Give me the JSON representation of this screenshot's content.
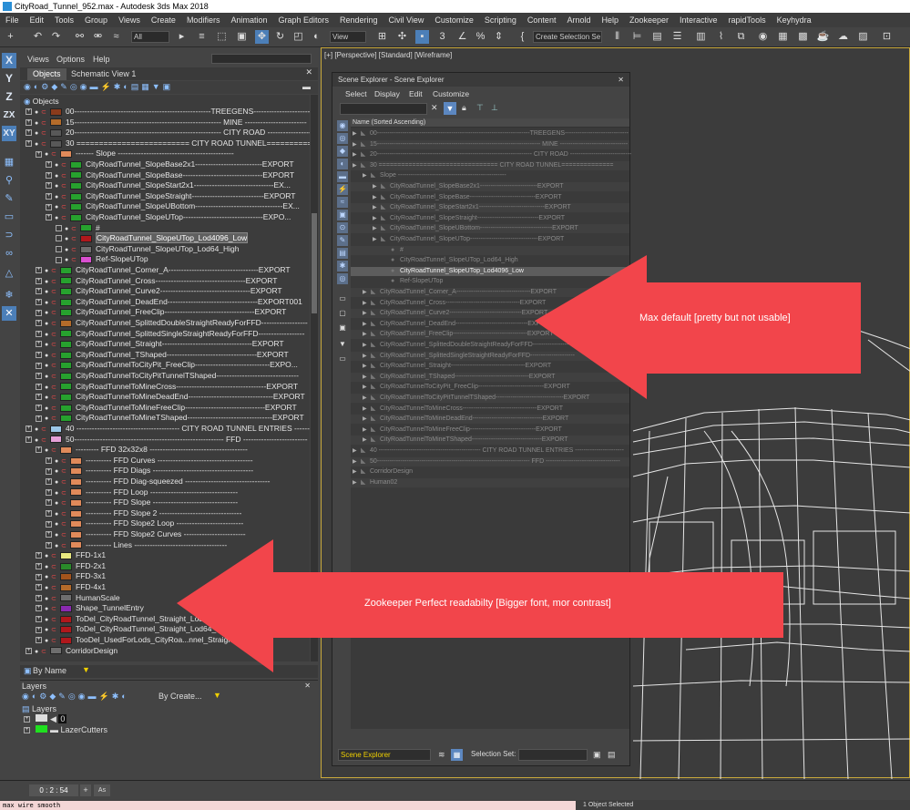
{
  "window": {
    "title": "CityRoad_Tunnel_952.max - Autodesk 3ds Max 2018"
  },
  "menu": [
    "File",
    "Edit",
    "Tools",
    "Group",
    "Views",
    "Create",
    "Modifiers",
    "Animation",
    "Graph Editors",
    "Rendering",
    "Civil View",
    "Customize",
    "Scripting",
    "Content",
    "Arnold",
    "Help",
    "Zookeeper",
    "Interactive",
    "rapidTools",
    "Keyhydra"
  ],
  "toolbar": {
    "filter_select": "All",
    "ref_coord": "View",
    "selection_set": "Create Selection Se"
  },
  "axis_buttons": [
    "X",
    "Y",
    "Z",
    "ZX",
    "XY"
  ],
  "left_panel": {
    "menu": [
      "Views",
      "Options",
      "Help"
    ],
    "tabs": [
      "Objects",
      "Schematic View 1"
    ],
    "root": "Objects",
    "rows": [
      {
        "text": "00-----------------------------------------------------TREEGENS----------------------------",
        "swatch": "#8a3b1c",
        "indent": 0,
        "sel": false
      },
      {
        "text": "15--------------------------------------------------------- MINE ------------------------",
        "swatch": "#b36b2a",
        "indent": 0,
        "sel": false
      },
      {
        "text": "20--------------------------------------------------------- CITY  ROAD -------------------",
        "swatch": "#585858",
        "indent": 0,
        "sel": false
      },
      {
        "text": "30  ========================= CITY ROAD TUNNEL==========",
        "swatch": "#585858",
        "indent": 0,
        "sel": false
      },
      {
        "text": "------- Slope ---------------------------------------------",
        "swatch": "#e08a5a",
        "indent": 1,
        "sel": false
      },
      {
        "text": "CityRoadTunnel_SlopeBase2x1--------------------------EXPORT",
        "swatch": "#27a12e",
        "indent": 2,
        "sel": false
      },
      {
        "text": "CityRoadTunnel_SlopeBase-------------------------------EXPORT",
        "swatch": "#27a12e",
        "indent": 2,
        "sel": false
      },
      {
        "text": "CityRoadTunnel_SlopeStart2x1-------------------------------EX...",
        "swatch": "#27a12e",
        "indent": 2,
        "sel": false
      },
      {
        "text": "CityRoadTunnel_SlopeStraight----------------------------EXPORT",
        "swatch": "#27a12e",
        "indent": 2,
        "sel": false
      },
      {
        "text": "CityRoadTunnel_SlopeUBottom----------------------------------EX...",
        "swatch": "#27a12e",
        "indent": 2,
        "sel": false
      },
      {
        "text": "CityRoadTunnel_SlopeUTop-------------------------------EXPO...",
        "swatch": "#27a12e",
        "indent": 2,
        "sel": false
      },
      {
        "text": "#",
        "swatch": "#27a12e",
        "indent": 3,
        "sel": false
      },
      {
        "text": "CityRoadTunnel_SlopeUTop_Lod4096_Low",
        "swatch": "#b0181c",
        "indent": 3,
        "sel": true
      },
      {
        "text": "CityRoadTunnel_SlopeUTop_Lod64_High",
        "swatch": "#6e6e6e",
        "indent": 3,
        "sel": false
      },
      {
        "text": "Ref-SlopeUTop",
        "swatch": "#d94fd0",
        "indent": 3,
        "sel": false
      },
      {
        "text": "CityRoadTunnel_Corner_A-----------------------------------EXPORT",
        "swatch": "#27a12e",
        "indent": 1,
        "sel": false
      },
      {
        "text": "CityRoadTunnel_Cross-----------------------------------EXPORT",
        "swatch": "#27a12e",
        "indent": 1,
        "sel": false
      },
      {
        "text": "CityRoadTunnel_Curve2-----------------------------------EXPORT",
        "swatch": "#27a12e",
        "indent": 1,
        "sel": false
      },
      {
        "text": "CityRoadTunnel_DeadEnd-----------------------------------EXPORT001",
        "swatch": "#27a12e",
        "indent": 1,
        "sel": false
      },
      {
        "text": "CityRoadTunnel_FreeClip-----------------------------------EXPORT",
        "swatch": "#27a12e",
        "indent": 1,
        "sel": false
      },
      {
        "text": "CityRoadTunnel_SplittedDoubleStraightReadyForFFD------------------",
        "swatch": "#b36b2a",
        "indent": 1,
        "sel": false
      },
      {
        "text": "CityRoadTunnel_SplittedSingleStraightReadyForFFD------------------",
        "swatch": "#27a12e",
        "indent": 1,
        "sel": false
      },
      {
        "text": "CityRoadTunnel_Straight-----------------------------------EXPORT",
        "swatch": "#27a12e",
        "indent": 1,
        "sel": false
      },
      {
        "text": "CityRoadTunnel_TShaped-----------------------------------EXPORT",
        "swatch": "#27a12e",
        "indent": 1,
        "sel": false
      },
      {
        "text": "CityRoadTunnelToCityPit_FreeClip-----------------------------EXPO...",
        "swatch": "#27a12e",
        "indent": 1,
        "sel": false
      },
      {
        "text": "CityRoadTunnelToCityPitTunnelTShaped--------------------------------",
        "swatch": "#27a12e",
        "indent": 1,
        "sel": false
      },
      {
        "text": "CityRoadTunnelToMineCross-----------------------------------EXPORT",
        "swatch": "#27a12e",
        "indent": 1,
        "sel": false
      },
      {
        "text": "CityRoadTunnelToMineDeadEnd---------------------------------EXPORT",
        "swatch": "#27a12e",
        "indent": 1,
        "sel": false
      },
      {
        "text": "CityRoadTunnelToMineFreeClip-------------------------------EXPORT",
        "swatch": "#27a12e",
        "indent": 1,
        "sel": false
      },
      {
        "text": "CityRoadTunnelToMineTShaped---------------------------------EXPORT",
        "swatch": "#27a12e",
        "indent": 1,
        "sel": false
      },
      {
        "text": "40  ---------------------------------------- CITY ROAD TUNNEL ENTRIES ----------",
        "swatch": "#9cc7e8",
        "indent": 0,
        "sel": false
      },
      {
        "text": "50---------------------------------------------------------- FFD -------------------------",
        "swatch": "#e6a0d8",
        "indent": 0,
        "sel": false
      },
      {
        "text": "--------- FFD 32x32x8 --------------------------------------",
        "swatch": "#e08a5a",
        "indent": 1,
        "sel": false
      },
      {
        "text": "---------- FFD Curves -------------------------------------",
        "swatch": "#e08a5a",
        "indent": 2,
        "sel": false
      },
      {
        "text": "---------- FFD Diags ---------------------------------------",
        "swatch": "#e08a5a",
        "indent": 2,
        "sel": false
      },
      {
        "text": "---------- FFD Diag-squeezed ---------------------------------",
        "swatch": "#e08a5a",
        "indent": 2,
        "sel": false
      },
      {
        "text": "---------- FFD Loop ----------------------------------",
        "swatch": "#e08a5a",
        "indent": 2,
        "sel": false
      },
      {
        "text": "---------- FFD Slope ---------------------------------",
        "swatch": "#e08a5a",
        "indent": 2,
        "sel": false
      },
      {
        "text": "---------- FFD Slope 2 --------------------------------",
        "swatch": "#e08a5a",
        "indent": 2,
        "sel": false
      },
      {
        "text": "---------- FFD Slope2  Loop --------------------------",
        "swatch": "#e08a5a",
        "indent": 2,
        "sel": false
      },
      {
        "text": "---------- FFD Slope2 Curves ------------------------",
        "swatch": "#e08a5a",
        "indent": 2,
        "sel": false
      },
      {
        "text": "---------- Lines ------------------------------------",
        "swatch": "#e08a5a",
        "indent": 2,
        "sel": false
      },
      {
        "text": "FFD-1x1",
        "swatch": "#e8e880",
        "indent": 1,
        "sel": false
      },
      {
        "text": "FFD-2x1",
        "swatch": "#2a8a2a",
        "indent": 1,
        "sel": false
      },
      {
        "text": "FFD-3x1",
        "swatch": "#a3541c",
        "indent": 1,
        "sel": false
      },
      {
        "text": "FFD-4x1",
        "swatch": "#b36b2a",
        "indent": 1,
        "sel": false
      },
      {
        "text": "HumanScale",
        "swatch": "#6e6e6e",
        "indent": 1,
        "sel": false
      },
      {
        "text": "Shape_TunnelEntry",
        "swatch": "#8a2ab0",
        "indent": 1,
        "sel": false
      },
      {
        "text": "ToDel_CityRoadTunnel_Straight_Lod...",
        "swatch": "#b0181c",
        "indent": 1,
        "sel": false
      },
      {
        "text": "ToDel_CityRoadTunnel_Straight_Lod64_H...",
        "swatch": "#b0181c",
        "indent": 1,
        "sel": false
      },
      {
        "text": "TooDel_UsedForLods_CityRoa...nnel_Straight_...w001",
        "swatch": "#b0181c",
        "indent": 1,
        "sel": false
      },
      {
        "text": "CorridorDesign",
        "swatch": "#6e6e6e",
        "indent": 0,
        "sel": false
      }
    ],
    "bottom_filter": "By Name"
  },
  "layers_panel": {
    "title": "Layers",
    "filter": "By Create...",
    "root": "Layers",
    "items": [
      "0",
      "LazerCutters"
    ]
  },
  "scene_explorer": {
    "title": "Scene Explorer - Scene Explorer",
    "menu": [
      "Select",
      "Display",
      "Edit",
      "Customize"
    ],
    "header": "Name (Sorted Ascending)",
    "rows": [
      {
        "text": "00------------------------------------------------------------------------TREEGENS------------------------------",
        "indent": 0
      },
      {
        "text": "15----------------------------------------------------------------------------- MINE --------------------------------",
        "indent": 0
      },
      {
        "text": "20------------------------------------------------------------------------- CITY  ROAD -----------------------------",
        "indent": 0
      },
      {
        "text": "30 ================================ CITY ROAD TUNNEL==============",
        "indent": 0
      },
      {
        "text": "Slope ---------------------------------------------------",
        "indent": 1
      },
      {
        "text": "CityRoadTunnel_SlopeBase2x1---------------------------EXPORT",
        "indent": 2
      },
      {
        "text": "CityRoadTunnel_SlopeBase-------------------------------EXPORT",
        "indent": 2
      },
      {
        "text": "CityRoadTunnel_SlopeStart2x1-------------------------------EXPORT",
        "indent": 2
      },
      {
        "text": "CityRoadTunnel_SlopeStraight-----------------------------EXPORT",
        "indent": 2
      },
      {
        "text": "CityRoadTunnel_SlopeUBottom----------------------------------EXPORT",
        "indent": 2
      },
      {
        "text": "CityRoadTunnel_SlopeUTop--------------------------------EXPORT",
        "indent": 2
      },
      {
        "text": "#",
        "indent": 3
      },
      {
        "text": "CityRoadTunnel_SlopeUTop_Lod64_High",
        "indent": 3
      },
      {
        "text": "CityRoadTunnel_SlopeUTop_Lod4096_Low",
        "indent": 3
      },
      {
        "text": "Ref-SlopeUTop",
        "indent": 3
      },
      {
        "text": "CityRoadTunnel_Corner_A-----------------------------------EXPORT",
        "indent": 1
      },
      {
        "text": "CityRoadTunnel_Cross-----------------------------------EXPORT",
        "indent": 1
      },
      {
        "text": "CityRoadTunnel_Curve2----------------------------------EXPORT",
        "indent": 1
      },
      {
        "text": "CityRoadTunnel_DeadEnd----------------------------------EXPORT001",
        "indent": 1
      },
      {
        "text": "CityRoadTunnel_FreeClip-----------------------------------EXPORT",
        "indent": 1
      },
      {
        "text": "CityRoadTunnel_SplittedDoubleStraightReadyForFFD------------------",
        "indent": 1
      },
      {
        "text": "CityRoadTunnel_SplittedSingleStraightReadyForFFD---------------------",
        "indent": 1
      },
      {
        "text": "CityRoadTunnel_Straight-----------------------------------EXPORT",
        "indent": 1
      },
      {
        "text": "CityRoadTunnel_TShaped-----------------------------------EXPORT",
        "indent": 1
      },
      {
        "text": "CityRoadTunnelToCityPit_FreeClip-------------------------------EXPORT",
        "indent": 1
      },
      {
        "text": "CityRoadTunnelToCityPitTunnelTShaped--------------------------------EXPORT",
        "indent": 1
      },
      {
        "text": "CityRoadTunnelToMineCross-----------------------------------EXPORT",
        "indent": 1
      },
      {
        "text": "CityRoadTunnelToMineDeadEnd---------------------------------EXPORT",
        "indent": 1
      },
      {
        "text": "CityRoadTunnelToMineFreeClip-------------------------------EXPORT",
        "indent": 1
      },
      {
        "text": "CityRoadTunnelToMineTShaped---------------------------------EXPORT",
        "indent": 1
      },
      {
        "text": "40 ------------------------------------------------ CITY ROAD TUNNEL ENTRIES -----------------------",
        "indent": 0
      },
      {
        "text": "50------------------------------------------------------------------------ FFD -----------------------------------",
        "indent": 0
      },
      {
        "text": "CorridorDesign",
        "indent": 0
      },
      {
        "text": "Human02",
        "indent": 0
      }
    ],
    "highlight_index": 13,
    "bottom_dropdown": "Scene Explorer",
    "selection_set_label": "Selection Set:"
  },
  "viewport": {
    "label": "[+] [Perspective] [Standard] [Wireframe]"
  },
  "annotations": {
    "max_default": "Max default [pretty but not usable]",
    "zookeeper": "Zookeeper Perfect readabilty [Bigger font, mor contrast]"
  },
  "timebar": {
    "time": "0 : 2 : 54"
  },
  "status": {
    "maxscript": "max wire smooth",
    "selection": "1 Object Selected"
  },
  "colors": {
    "accent": "#4c7fb8",
    "arrow_red": "#f2454b",
    "viewport_border": "#c9a93c"
  }
}
